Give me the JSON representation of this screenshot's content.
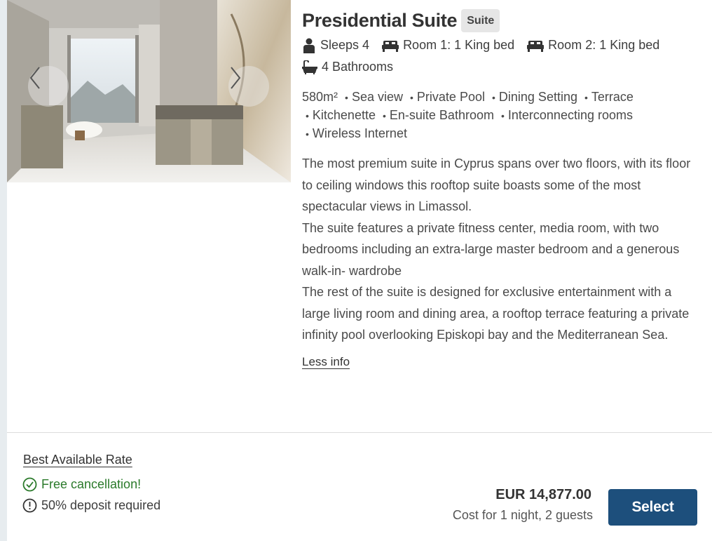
{
  "room": {
    "title": "Presidential Suite",
    "type_badge": "Suite",
    "sleeps": "Sleeps 4",
    "room1": "Room 1: 1 King bed",
    "room2": "Room 2: 1 King bed",
    "bathrooms": "4 Bathrooms",
    "size": "580m²",
    "amenities": [
      "Sea view",
      "Private Pool",
      "Dining Setting",
      "Terrace",
      "Kitchenette",
      "En-suite Bathroom",
      "Interconnecting rooms",
      "Wireless Internet"
    ],
    "description": [
      "The most premium suite in Cyprus spans over two floors, with its floor to ceiling windows this rooftop suite boasts some of the most spectacular views in Limassol.",
      "The suite features a private fitness center, media room, with two bedrooms including an extra-large master bedroom and a generous walk-in- wardrobe",
      "The rest of the suite is designed for exclusive entertainment with a large living room and dining area, a rooftop terrace featuring a private infinity pool overlooking Episkopi bay and the Mediterranean Sea."
    ],
    "less_info_label": "Less info"
  },
  "gallery": {
    "prev_icon": "chevron-left-icon",
    "next_icon": "chevron-right-icon"
  },
  "rate": {
    "name": "Best Available Rate",
    "cancellation": "Free cancellation!",
    "deposit": "50% deposit required",
    "price": "EUR 14,877.00",
    "price_note": "Cost for 1 night, 2 guests",
    "select_label": "Select"
  },
  "colors": {
    "accent": "#1d4f7c",
    "success": "#2b7a2b",
    "badge_bg": "#e6e6e6"
  }
}
